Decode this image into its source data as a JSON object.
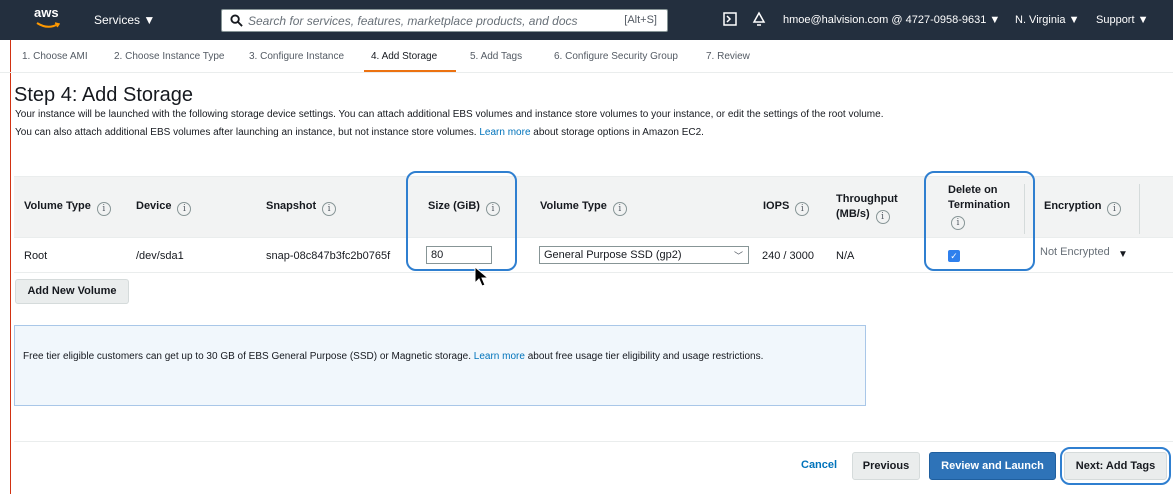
{
  "topnav": {
    "logo_text": "aws",
    "services_label": "Services ▼",
    "search_placeholder": "Search for services, features, marketplace products, and docs",
    "search_shortcut": "[Alt+S]",
    "account": "hmoe@halvision.com @ 4727-0958-9631 ▼",
    "region": "N. Virginia ▼",
    "support": "Support ▼"
  },
  "steps": [
    {
      "label": "1. Choose AMI"
    },
    {
      "label": "2. Choose Instance Type"
    },
    {
      "label": "3. Configure Instance"
    },
    {
      "label": "4. Add Storage",
      "active": true
    },
    {
      "label": "5. Add Tags"
    },
    {
      "label": "6. Configure Security Group"
    },
    {
      "label": "7. Review"
    }
  ],
  "page": {
    "title": "Step 4: Add Storage",
    "description_1": "Your instance will be launched with the following storage device settings. You can attach additional EBS volumes and instance store volumes to your instance, or edit the settings of the root volume. You can also attach additional EBS volumes after launching an instance, but not instance store volumes. ",
    "description_link": "Learn more",
    "description_2": " about storage options in Amazon EC2."
  },
  "table": {
    "headers": {
      "volume_type": "Volume Type",
      "device": "Device",
      "snapshot": "Snapshot",
      "size": "Size (GiB)",
      "ebs_volume_type": "Volume Type",
      "iops": "IOPS",
      "throughput_1": "Throughput",
      "throughput_2": "(MB/s)",
      "delete_1": "Delete on",
      "delete_2": "Termination",
      "encryption": "Encryption"
    },
    "info_glyph": "i",
    "row": {
      "volume_type": "Root",
      "device": "/dev/sda1",
      "snapshot": "snap-08c847b3fc2b0765f",
      "size": "80",
      "ebs_volume_type": "General Purpose SSD (gp2)",
      "iops": "240 / 3000",
      "throughput": "N/A",
      "delete_on_termination": true,
      "encryption": "Not Encrypted"
    },
    "add_volume_label": "Add New Volume"
  },
  "info_box": {
    "text_1": "Free tier eligible customers can get up to 30 GB of EBS General Purpose (SSD) or Magnetic storage. ",
    "link": "Learn more",
    "text_2": " about free usage tier eligibility and usage restrictions."
  },
  "footer": {
    "cancel": "Cancel",
    "previous": "Previous",
    "review_launch": "Review and Launch",
    "next": "Next: Add Tags"
  },
  "colors": {
    "nav_bg": "#232f3e",
    "primary_button": "#2e73b8",
    "highlight": "#2f7fd0",
    "active_step": "#ec7211",
    "link": "#0073bb"
  },
  "icons": [
    "aws-logo",
    "search-icon",
    "cloudshell-icon",
    "bell-icon",
    "info-icon",
    "checkbox-checked-icon",
    "dropdown-caret-icon",
    "mouse-pointer-icon"
  ]
}
